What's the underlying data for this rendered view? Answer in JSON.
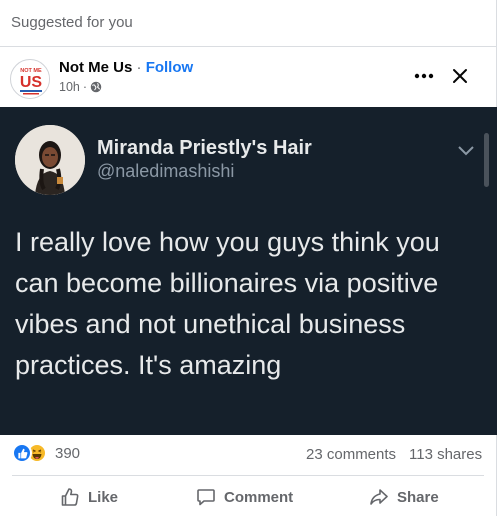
{
  "post": {
    "suggested_label": "Suggested for you",
    "page_name": "Not Me Us",
    "separator": "·",
    "follow_label": "Follow",
    "time": "10h",
    "time_sep": "·",
    "logo_text": "US",
    "logo_top_text": "NOT ME"
  },
  "tweet": {
    "display_name": "Miranda Priestly's Hair",
    "handle": "@naledimashishi",
    "text": "I really love how you guys think you can become billionaires via positive vibes and not unethical business practices. It's amazing"
  },
  "stats": {
    "reactions_count": "390",
    "comments": "23 comments",
    "shares": "113 shares"
  },
  "actions": {
    "like": "Like",
    "comment": "Comment",
    "share": "Share"
  },
  "colors": {
    "accent": "#1877f2",
    "tweet_bg": "#15202b",
    "muted": "#65676b"
  }
}
